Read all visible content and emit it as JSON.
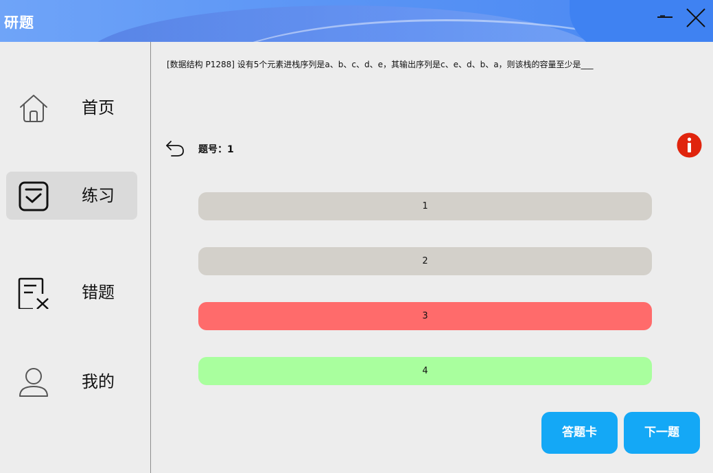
{
  "window": {
    "title": "研题",
    "minimize_icon": "minimize-icon",
    "close_icon": "close-icon"
  },
  "sidebar": {
    "items": [
      {
        "label": "首页",
        "icon": "home-icon",
        "active": false
      },
      {
        "label": "练习",
        "icon": "checkbox-icon",
        "active": true
      },
      {
        "label": "错题",
        "icon": "wrong-list-icon",
        "active": false
      },
      {
        "label": "我的",
        "icon": "user-icon",
        "active": false
      }
    ]
  },
  "question": {
    "text": "[数据结构 P1288] 设有5个元素进栈序列是a、b、c、d、e，其输出序列是c、e、d、b、a，则该栈的容量至少是___",
    "number_label": "题号：1"
  },
  "options": [
    {
      "label": "1",
      "state": "neutral"
    },
    {
      "label": "2",
      "state": "neutral"
    },
    {
      "label": "3",
      "state": "wrong"
    },
    {
      "label": "4",
      "state": "correct"
    }
  ],
  "actions": {
    "answer_card_label": "答题卡",
    "next_label": "下一题"
  },
  "colors": {
    "accent": "#14a8f6",
    "wrong": "#ff6b6b",
    "correct": "#a9ff9e",
    "neutral": "#d3d0ca",
    "info": "#e0240d"
  }
}
